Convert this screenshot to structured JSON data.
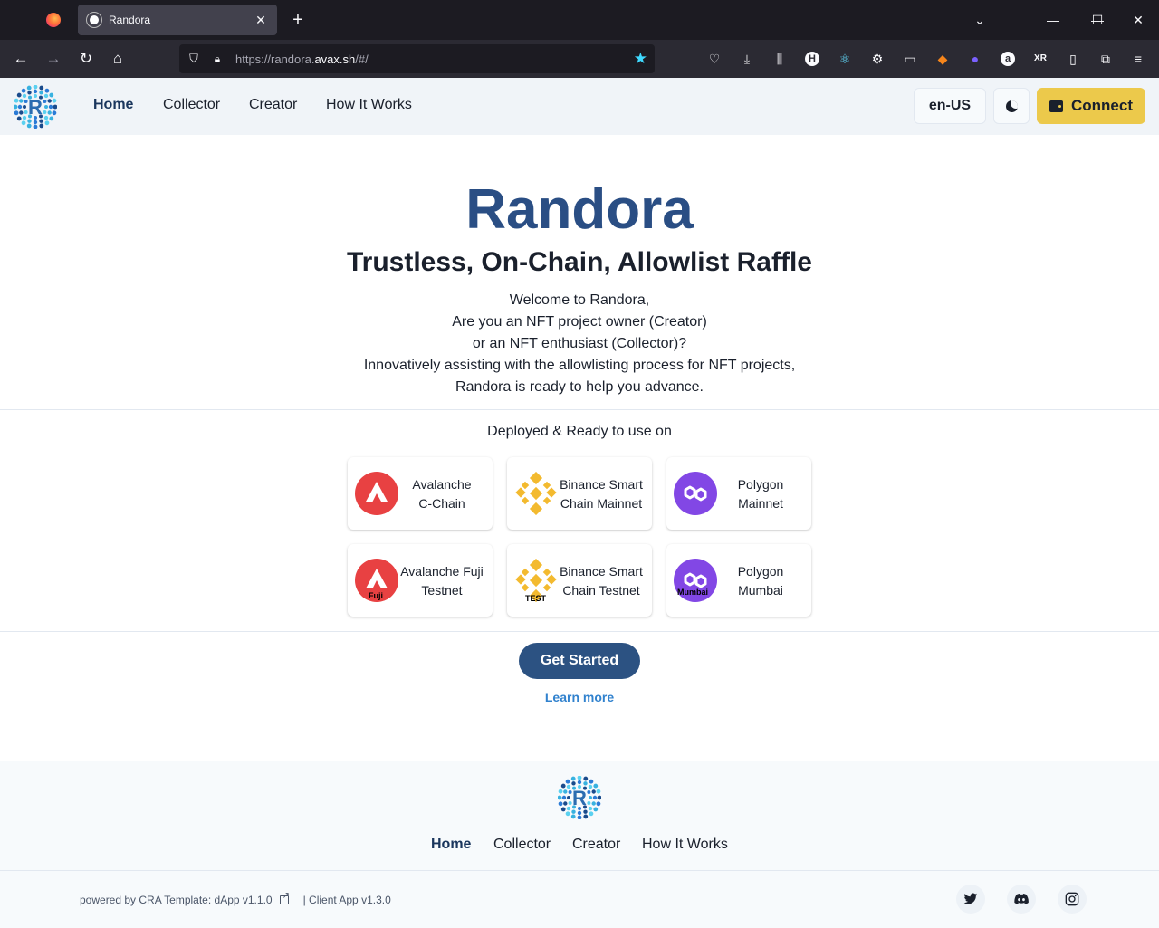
{
  "browser": {
    "tab_title": "Randora",
    "url_prefix": "https://randora.",
    "url_host": "avax.sh",
    "url_suffix": "/#/",
    "extension_letters": [
      "H",
      "a",
      "XR"
    ]
  },
  "header": {
    "nav": [
      "Home",
      "Collector",
      "Creator",
      "How It Works"
    ],
    "active_nav": "Home",
    "lang": "en-US",
    "connect": "Connect"
  },
  "hero": {
    "title": "Randora",
    "subtitle": "Trustless, On-Chain, Allowlist Raffle",
    "lines": [
      "Welcome to Randora,",
      "Are you an NFT project owner (Creator)",
      "or an NFT enthusiast (Collector)?",
      "Innovatively assisting with the allowlisting process for NFT projects,",
      "Randora is ready to help you advance."
    ]
  },
  "deployed_title": "Deployed & Ready to use on",
  "chains": [
    {
      "name_line1": "Avalanche",
      "name_line2": "C-Chain",
      "icon": "avalanche-icon",
      "badge": "",
      "color": "#e84142"
    },
    {
      "name_line1": "Binance Smart",
      "name_line2": "Chain Mainnet",
      "icon": "binance-icon",
      "badge": "",
      "color": "#f3ba2f"
    },
    {
      "name_line1": "Polygon",
      "name_line2": "Mainnet",
      "icon": "polygon-icon",
      "badge": "",
      "color": "#8247e5"
    },
    {
      "name_line1": "Avalanche Fuji",
      "name_line2": "Testnet",
      "icon": "avalanche-icon",
      "badge": "Fuji",
      "color": "#e84142"
    },
    {
      "name_line1": "Binance Smart",
      "name_line2": "Chain Testnet",
      "icon": "binance-icon",
      "badge": "TEST",
      "color": "#f3ba2f"
    },
    {
      "name_line1": "Polygon",
      "name_line2": "Mumbai",
      "icon": "polygon-icon",
      "badge": "Mumbai",
      "color": "#8247e5"
    }
  ],
  "cta": {
    "get_started": "Get Started",
    "learn_more": "Learn more"
  },
  "footer": {
    "nav": [
      "Home",
      "Collector",
      "Creator",
      "How It Works"
    ],
    "powered": "powered by CRA Template: dApp v1.1.0",
    "client": "| Client App v1.3.0",
    "social": [
      "twitter-icon",
      "discord-icon",
      "instagram-icon"
    ]
  }
}
